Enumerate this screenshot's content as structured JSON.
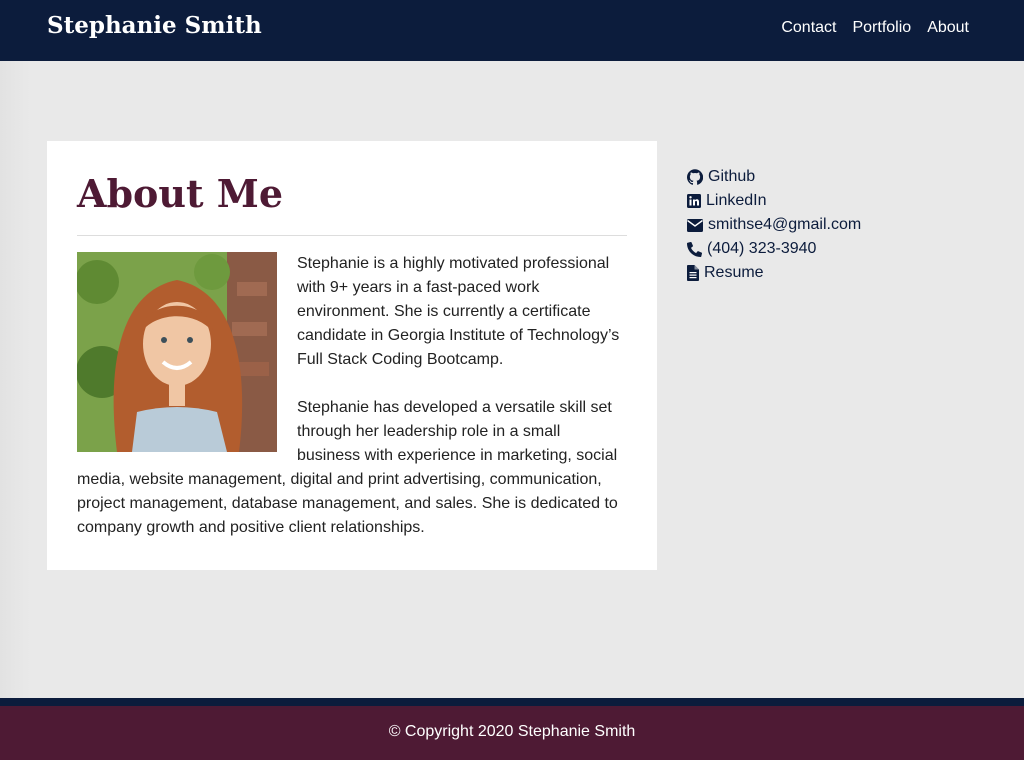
{
  "header": {
    "brand": "Stephanie Smith",
    "nav": [
      "Contact",
      "Portfolio",
      "About"
    ]
  },
  "about": {
    "title": "About Me",
    "paragraphs": [
      "Stephanie is a highly motivated professional with 9+ years in a fast-paced work environment. She is currently a certificate candidate in Georgia Institute of Technology’s Full Stack Coding Bootcamp.",
      "Stephanie has developed a versatile skill set through her leadership role in a small business with experience in marketing, social media, website management, digital and print advertising, communication, project management, database management, and sales. She is dedicated to company growth and positive client relationships."
    ]
  },
  "sidebar": {
    "links": [
      {
        "icon": "github-icon",
        "label": "Github"
      },
      {
        "icon": "linkedin-icon",
        "label": "LinkedIn"
      },
      {
        "icon": "envelope-icon",
        "label": "smithse4@gmail.com"
      },
      {
        "icon": "phone-icon",
        "label": "(404) 323-3940"
      },
      {
        "icon": "document-icon",
        "label": "Resume"
      }
    ]
  },
  "footer": {
    "text": "© Copyright 2020 Stephanie Smith"
  },
  "colors": {
    "navy": "#0c1c3c",
    "maroon": "#4e1a34",
    "background": "#e9e9e9"
  }
}
